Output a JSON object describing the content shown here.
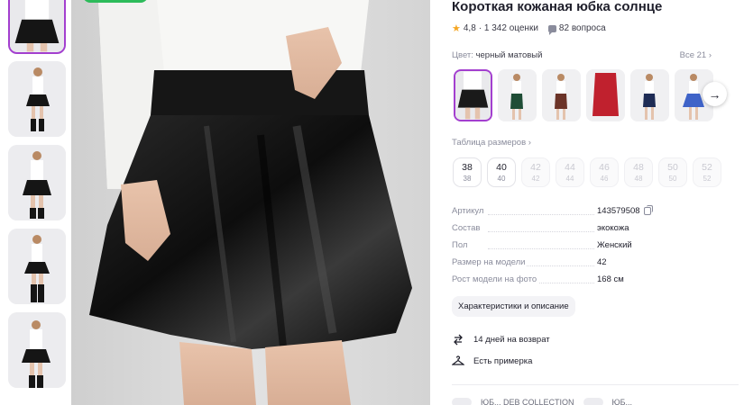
{
  "product": {
    "title": "Короткая кожаная юбка солнце",
    "rating": "4,8",
    "reviews": "· 1 342 оценки",
    "questions": "82 вопроса"
  },
  "colors": {
    "label": "Цвет:",
    "value": "черный матовый",
    "all_link": "Все 21 ›",
    "swatch_colors": [
      "#1a1a1a",
      "#1f4d36",
      "#6b3328",
      "#c0212e",
      "#1e2c55",
      "#3f63c8"
    ],
    "next_icon": "→"
  },
  "size_table": {
    "link": "Таблица размеров ›",
    "sizes": [
      {
        "ru": "38",
        "eu": "38",
        "available": true
      },
      {
        "ru": "40",
        "eu": "40",
        "available": true
      },
      {
        "ru": "42",
        "eu": "42",
        "available": false
      },
      {
        "ru": "44",
        "eu": "44",
        "available": false
      },
      {
        "ru": "46",
        "eu": "46",
        "available": false
      },
      {
        "ru": "48",
        "eu": "48",
        "available": false
      },
      {
        "ru": "50",
        "eu": "50",
        "available": false
      },
      {
        "ru": "52",
        "eu": "52",
        "available": false
      }
    ]
  },
  "specs": [
    {
      "key": "Артикул",
      "value": "143579508"
    },
    {
      "key": "Состав",
      "value": "экокожа"
    },
    {
      "key": "Пол",
      "value": "Женский"
    },
    {
      "key": "Размер на модели",
      "value": "42"
    },
    {
      "key": "Рост модели на фото",
      "value": "168 см"
    }
  ],
  "description_chip": "Характеристики и описание",
  "features": {
    "return": "14 дней на возврат",
    "fitting": "Есть примерка"
  },
  "bottom_cut": {
    "left": "ЮБ... DEB COLLECTION",
    "right": "ЮБ..."
  },
  "theme": {
    "accent": "#a33fcf",
    "brand_green": "#2dbb5a",
    "star": "#f5a623"
  }
}
